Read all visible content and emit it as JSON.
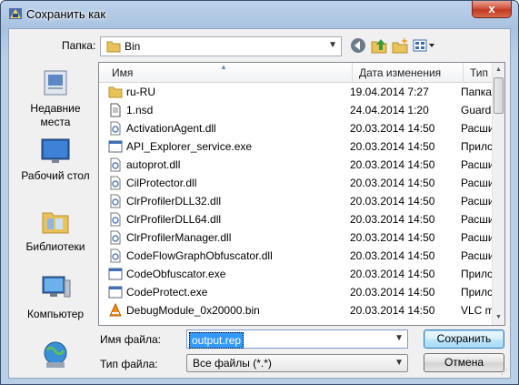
{
  "window": {
    "title": "Сохранить как",
    "close_glyph": "x"
  },
  "lookin": {
    "label": "Папка:",
    "value": "Bin"
  },
  "places": [
    {
      "label_lines": [
        "Недавние",
        "места"
      ],
      "icon": "recent-places-icon"
    },
    {
      "label_lines": [
        "Рабочий стол"
      ],
      "icon": "desktop-icon"
    },
    {
      "label_lines": [
        "Библиотеки"
      ],
      "icon": "libraries-icon"
    },
    {
      "label_lines": [
        "Компьютер"
      ],
      "icon": "computer-icon"
    },
    {
      "label_lines": [
        ""
      ],
      "icon": "network-icon"
    }
  ],
  "columns": {
    "name": "Имя",
    "date": "Дата изменения",
    "type": "Тип"
  },
  "files": [
    {
      "name": "ru-RU",
      "date": "19.04.2014 7:27",
      "type": "Папка",
      "icon": "folder"
    },
    {
      "name": "1.nsd",
      "date": "24.04.2014 1:20",
      "type": "Guarda",
      "icon": "doc"
    },
    {
      "name": "ActivationAgent.dll",
      "date": "20.03.2014 14:50",
      "type": "Расши",
      "icon": "dll"
    },
    {
      "name": "API_Explorer_service.exe",
      "date": "20.03.2014 14:50",
      "type": "Прилс",
      "icon": "exe"
    },
    {
      "name": "autoprot.dll",
      "date": "20.03.2014 14:50",
      "type": "Расши",
      "icon": "dll"
    },
    {
      "name": "CilProtector.dll",
      "date": "20.03.2014 14:50",
      "type": "Расши",
      "icon": "dll"
    },
    {
      "name": "ClrProfilerDLL32.dll",
      "date": "20.03.2014 14:50",
      "type": "Расши",
      "icon": "dll"
    },
    {
      "name": "ClrProfilerDLL64.dll",
      "date": "20.03.2014 14:50",
      "type": "Расши",
      "icon": "dll"
    },
    {
      "name": "ClrProfilerManager.dll",
      "date": "20.03.2014 14:50",
      "type": "Расши",
      "icon": "dll"
    },
    {
      "name": "CodeFlowGraphObfuscator.dll",
      "date": "20.03.2014 14:50",
      "type": "Расши",
      "icon": "dll"
    },
    {
      "name": "CodeObfuscator.exe",
      "date": "20.03.2014 14:50",
      "type": "Прилс",
      "icon": "exe"
    },
    {
      "name": "CodeProtect.exe",
      "date": "20.03.2014 14:50",
      "type": "Прилс",
      "icon": "exe"
    },
    {
      "name": "DebugModule_0x20000.bin",
      "date": "20.03.2014 14:50",
      "type": "VLC m",
      "icon": "vlc"
    }
  ],
  "filename": {
    "label": "Имя файла:",
    "value": "output.rep"
  },
  "filetype": {
    "label": "Тип файла:",
    "value": "Все файлы (*.*)"
  },
  "buttons": {
    "save": "Сохранить",
    "cancel": "Отмена"
  }
}
